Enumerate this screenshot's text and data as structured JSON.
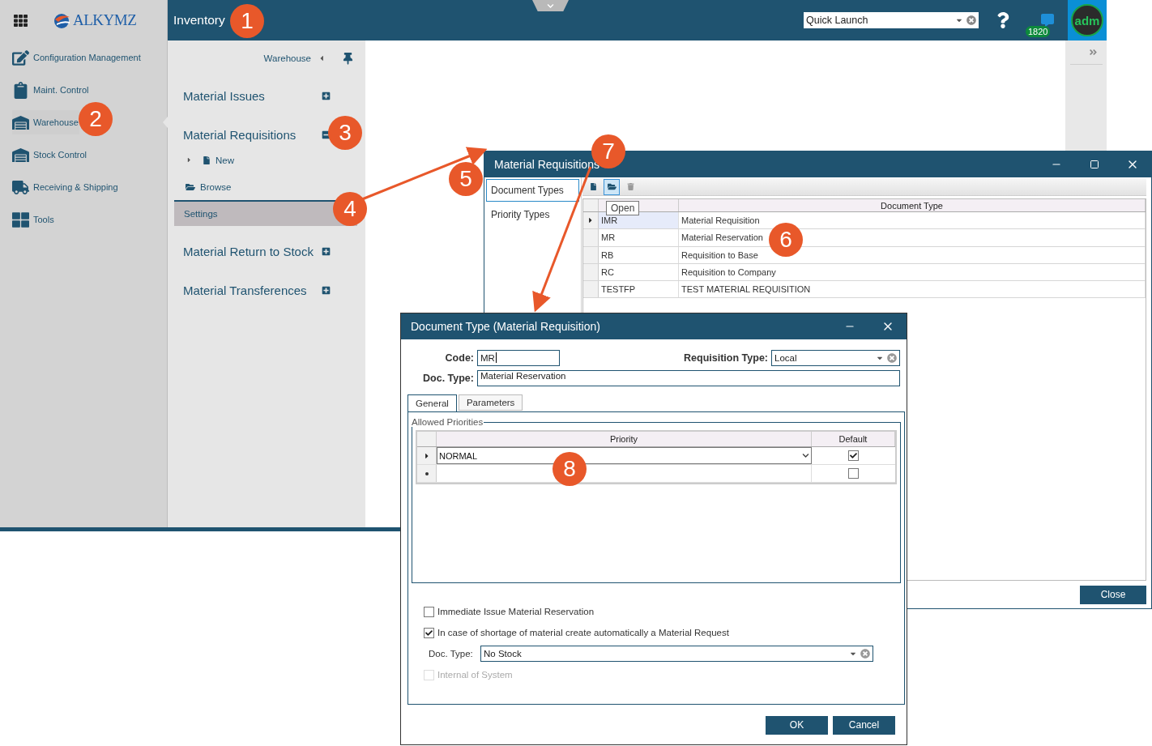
{
  "top_bar": {
    "title": "Inventory",
    "quick_launch": {
      "value": "Quick Launch"
    },
    "message_count": "1820",
    "avatar": "adm"
  },
  "sidebar": {
    "logo": "ALKYMZ",
    "items": [
      {
        "label": "Configuration Management",
        "selected": false
      },
      {
        "label": "Maint. Control",
        "selected": false
      },
      {
        "label": "Warehouse",
        "selected": true
      },
      {
        "label": "Stock Control",
        "selected": false
      },
      {
        "label": "Receiving & Shipping",
        "selected": false
      },
      {
        "label": "Tools",
        "selected": false
      }
    ]
  },
  "submenu": {
    "breadcrumb": "Warehouse",
    "sections": [
      {
        "label": "Material Issues",
        "expanded": false
      },
      {
        "label": "Material Requisitions",
        "expanded": true,
        "children": [
          {
            "kind": "new",
            "label": "New",
            "selected": false
          },
          {
            "kind": "browse",
            "label": "Browse",
            "selected": false
          },
          {
            "kind": "settings",
            "label": "Settings",
            "selected": true
          }
        ]
      },
      {
        "label": "Material Return to Stock",
        "expanded": false
      },
      {
        "label": "Material Transferences",
        "expanded": false
      }
    ]
  },
  "settings_window": {
    "title": "Material Requisitions",
    "nav": [
      {
        "label": "Document Types",
        "selected": true
      },
      {
        "label": "Priority Types",
        "selected": false
      }
    ],
    "tooltip": "Open",
    "columns": [
      "Document Type"
    ],
    "rows": [
      {
        "code": "IMR",
        "document_type": "Material Requisition",
        "selected": true
      },
      {
        "code": "MR",
        "document_type": "Material Reservation",
        "selected": false
      },
      {
        "code": "RB",
        "document_type": "Requisition to Base",
        "selected": false
      },
      {
        "code": "RC",
        "document_type": "Requisition to Company",
        "selected": false
      },
      {
        "code": "TESTFP",
        "document_type": "TEST MATERIAL REQUISITION",
        "selected": false
      }
    ],
    "close_button": "Close"
  },
  "dialog": {
    "title": "Document Type (Material Requisition)",
    "code": {
      "label": "Code:",
      "value": "MR"
    },
    "requisition_type": {
      "label": "Requisition Type:",
      "value": "Local"
    },
    "doc_type": {
      "label": "Doc. Type:",
      "value": "Material Reservation"
    },
    "tabs": [
      {
        "label": "General",
        "selected": true
      },
      {
        "label": "Parameters",
        "selected": false
      }
    ],
    "group_title": "Allowed Priorities",
    "columns": [
      "Priority",
      "Default"
    ],
    "rows": [
      {
        "kind": "current",
        "priority": "NORMAL",
        "default": true
      },
      {
        "kind": "new",
        "default": false
      }
    ],
    "options": [
      {
        "kind": "checkbox",
        "label": "Immediate Issue Material Reservation",
        "checked": false,
        "disabled": false
      },
      {
        "kind": "checkbox",
        "label": "In case of shortage of material create automatically a Material Request",
        "checked": true,
        "disabled": false
      },
      {
        "kind": "select",
        "label": "Doc. Type:",
        "value": "No Stock",
        "disabled": false
      },
      {
        "kind": "checkbox",
        "label": "Internal of System",
        "checked": false,
        "disabled": true
      }
    ],
    "buttons": [
      "OK",
      "Cancel"
    ]
  },
  "callouts": [
    "1",
    "2",
    "3",
    "4",
    "5",
    "6",
    "7",
    "8"
  ]
}
